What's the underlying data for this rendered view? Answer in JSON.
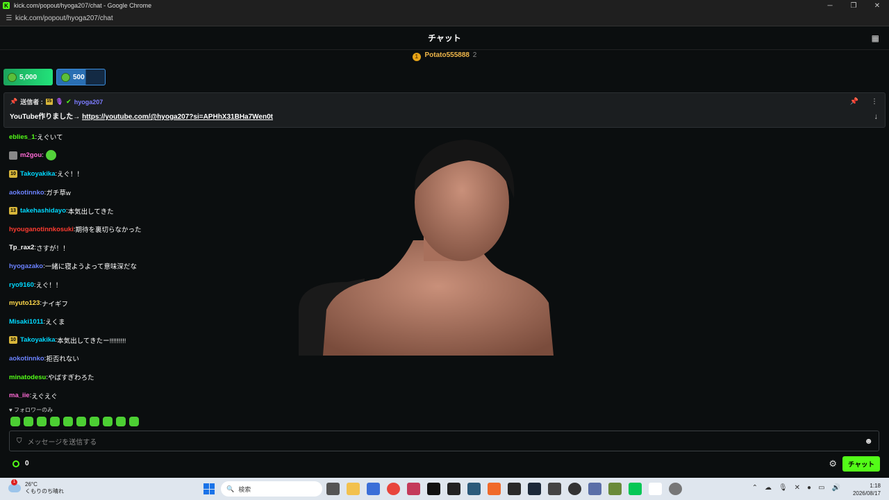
{
  "window": {
    "title": "kick.com/popout/hyoga207/chat - Google Chrome",
    "url": "kick.com/popout/hyoga207/chat"
  },
  "header": {
    "title": "チャット"
  },
  "gifter": {
    "name": "Potato555888",
    "count": "2"
  },
  "kicks": [
    {
      "amount": "5,000"
    },
    {
      "amount": "500"
    }
  ],
  "pinned": {
    "sender_label": "送信者 :",
    "badge": "15",
    "username": "hyoga207",
    "message_prefix": "YouTube作りました→",
    "link": "https://youtube.com/@hyoga207?si=APHhX31BHa7Wen0t"
  },
  "messages": [
    {
      "user": "eblies_1",
      "color": "#53fc18",
      "text": "えぐいて",
      "badge": "",
      "avatar": false,
      "emote": false
    },
    {
      "user": "m2gou",
      "color": "#ff6ad5",
      "text": "",
      "badge": "",
      "avatar": true,
      "emote": true
    },
    {
      "user": "Takoyakika",
      "color": "#00d9ff",
      "text": "えぐ！！",
      "badge": "10",
      "avatar": false,
      "emote": false
    },
    {
      "user": "aokotinnko",
      "color": "#6b82ff",
      "text": "ガチ草w",
      "badge": "",
      "avatar": false,
      "emote": false
    },
    {
      "user": "takehashidayo",
      "color": "#00d9ff",
      "text": "本気出してきた",
      "badge": "13",
      "avatar": false,
      "emote": false
    },
    {
      "user": "hyouganotinnkosuki",
      "color": "#ff3b30",
      "text": "期待を裏切らなかった",
      "badge": "",
      "avatar": false,
      "emote": false
    },
    {
      "user": "Tp_rax2",
      "color": "#ffffff",
      "text": "さすが！！",
      "badge": "",
      "avatar": false,
      "emote": false
    },
    {
      "user": "hyogazako",
      "color": "#6b82ff",
      "text": "一緒に寝ようよって意味深だな",
      "badge": "",
      "avatar": false,
      "emote": false
    },
    {
      "user": "ryo9160",
      "color": "#00d9ff",
      "text": "えぐ！！",
      "badge": "",
      "avatar": false,
      "emote": false
    },
    {
      "user": "myuto123",
      "color": "#ffd84a",
      "text": "ナイギフ",
      "badge": "",
      "avatar": false,
      "emote": false
    },
    {
      "user": "Misaki1011",
      "color": "#00d9ff",
      "text": "えくま",
      "badge": "",
      "avatar": false,
      "emote": false
    },
    {
      "user": "Takoyakika",
      "color": "#00d9ff",
      "text": "本気出してきたー!!!!!!!!!",
      "badge": "10",
      "avatar": false,
      "emote": false
    },
    {
      "user": "aokotinnko",
      "color": "#6b82ff",
      "text": "拒否れない",
      "badge": "",
      "avatar": false,
      "emote": false
    },
    {
      "user": "minatodesu",
      "color": "#53fc18",
      "text": "やばすぎわろた",
      "badge": "",
      "avatar": false,
      "emote": false
    },
    {
      "user": "ma_iie",
      "color": "#ff6ad5",
      "text": "えぐえぐ",
      "badge": "",
      "avatar": false,
      "emote": false
    }
  ],
  "followers_only": "フォロワーのみ",
  "input": {
    "placeholder": "メッセージを送信する"
  },
  "footer": {
    "kicks_count": "0",
    "chat_button": "チャット"
  },
  "taskbar": {
    "temperature": "26°C",
    "weather": "くもりのち晴れ",
    "weather_alert": "1",
    "search": "検索",
    "time": "1:18",
    "date": "2026/08/17"
  }
}
